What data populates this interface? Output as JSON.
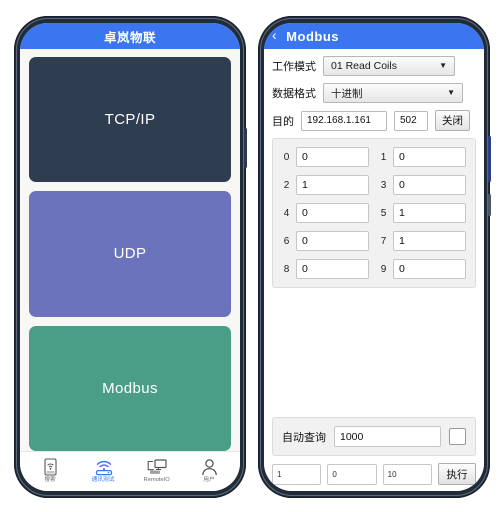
{
  "left_phone": {
    "appbar": {
      "title": "卓岚物联"
    },
    "cards": [
      {
        "label": "TCP/IP",
        "color": "#2e3e50"
      },
      {
        "label": "UDP",
        "color": "#6b73bd"
      },
      {
        "label": "Modbus",
        "color": "#4a9e87"
      }
    ],
    "tabbar": {
      "items": [
        {
          "label": "搜索",
          "icon": "device-search-icon",
          "active": false
        },
        {
          "label": "通讯测试",
          "icon": "wifi-router-icon",
          "active": true
        },
        {
          "label": "RemoteIO",
          "icon": "remote-io-icon",
          "active": false
        },
        {
          "label": "用户",
          "icon": "user-icon",
          "active": false
        }
      ],
      "active_color": "#3b76f0"
    }
  },
  "right_phone": {
    "appbar": {
      "back_icon": "chevron-left-icon",
      "title": "Modbus"
    },
    "form": {
      "mode_label": "工作模式",
      "mode_value": "01 Read Coils",
      "format_label": "数据格式",
      "format_value": "十进制",
      "target_label": "目的",
      "ip_value": "192.168.1.161",
      "ip_placeholder": "192.168.1.161",
      "port_value": "502",
      "port_placeholder": "502",
      "close_button": "关闭"
    },
    "registers": [
      {
        "index": "0",
        "value": "0"
      },
      {
        "index": "1",
        "value": "0"
      },
      {
        "index": "2",
        "value": "1"
      },
      {
        "index": "3",
        "value": "0"
      },
      {
        "index": "4",
        "value": "0"
      },
      {
        "index": "5",
        "value": "1"
      },
      {
        "index": "6",
        "value": "0"
      },
      {
        "index": "7",
        "value": "1"
      },
      {
        "index": "8",
        "value": "0"
      },
      {
        "index": "9",
        "value": "0"
      }
    ],
    "auto": {
      "label": "自动查询",
      "interval_value": "1000",
      "interval_placeholder": "1000",
      "checkbox_checked": false
    },
    "exec": {
      "field1": "1",
      "field2": "0",
      "field3": "10",
      "button": "执行"
    }
  },
  "theme": {
    "appbar_blue": "#3b76f0",
    "phone_frame": "#222c38",
    "screen_bg": "#f7f7f5"
  }
}
